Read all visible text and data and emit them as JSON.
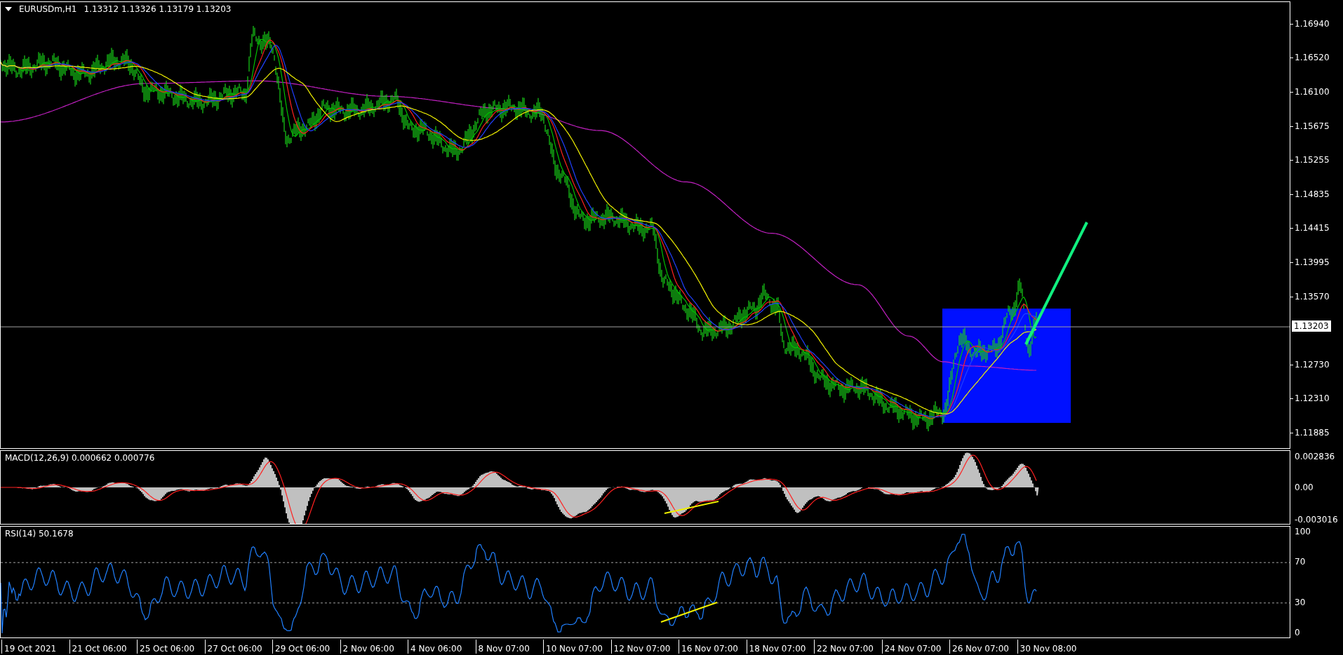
{
  "chart": {
    "symbol": "EURUSDm,H1",
    "ohlc": "1.13312 1.13326 1.13179 1.13203",
    "price_axis": [
      "1.16940",
      "1.16520",
      "1.16100",
      "1.15675",
      "1.15255",
      "1.14835",
      "1.14415",
      "1.13995",
      "1.13570",
      "1.12730",
      "1.12310",
      "1.11885"
    ],
    "current_price": "1.13203"
  },
  "macd": {
    "label": "MACD(12,26,9) 0.000662 0.000776",
    "axis": [
      "0.002836",
      "0.00",
      "-0.003016"
    ]
  },
  "rsi": {
    "label": "RSI(14) 50.1678",
    "axis": [
      "100",
      "70",
      "30",
      "0"
    ]
  },
  "time_axis": [
    "19 Oct 2021",
    "21 Oct 06:00",
    "25 Oct 06:00",
    "27 Oct 06:00",
    "29 Oct 06:00",
    "2 Nov 06:00",
    "4 Nov 06:00",
    "8 Nov 07:00",
    "10 Nov 07:00",
    "12 Nov 07:00",
    "16 Nov 07:00",
    "18 Nov 07:00",
    "22 Nov 07:00",
    "24 Nov 07:00",
    "26 Nov 07:00",
    "30 Nov 08:00"
  ]
}
